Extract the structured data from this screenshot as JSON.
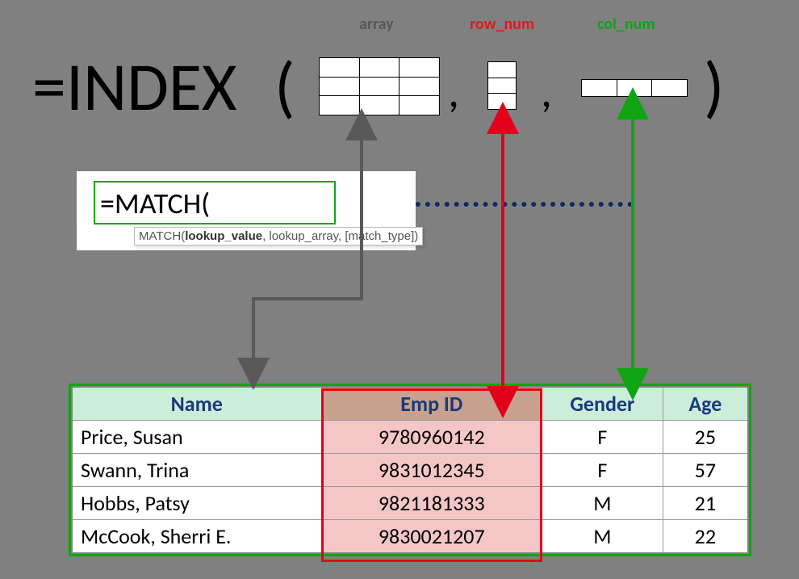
{
  "labels": {
    "array": "array",
    "row_num": "row_num",
    "col_num": "col_num"
  },
  "formula": {
    "index_text": "=INDEX",
    "open": "(",
    "close": ")",
    "comma": ","
  },
  "match": {
    "cell_text": "=MATCH(",
    "tooltip_fn": "MATCH(",
    "tooltip_arg1": "lookup_value",
    "tooltip_rest": ", lookup_array, [match_type])"
  },
  "table": {
    "headers": {
      "name": "Name",
      "empid": "Emp ID",
      "gender": "Gender",
      "age": "Age"
    },
    "rows": [
      {
        "name": "Price, Susan",
        "empid": "9780960142",
        "gender": "F",
        "age": "25"
      },
      {
        "name": "Swann, Trina",
        "empid": "9831012345",
        "gender": "F",
        "age": "57"
      },
      {
        "name": "Hobbs, Patsy",
        "empid": "9821181333",
        "gender": "M",
        "age": "21"
      },
      {
        "name": "McCook, Sherri E.",
        "empid": "9830021207",
        "gender": "M",
        "age": "22"
      }
    ]
  }
}
